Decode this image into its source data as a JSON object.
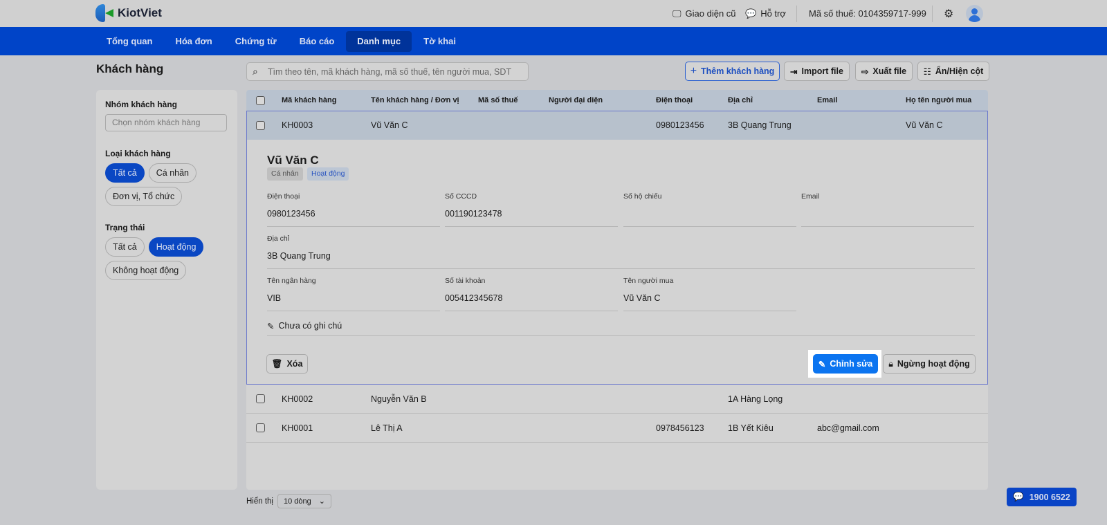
{
  "brand": {
    "name": "KiotViet"
  },
  "topbar": {
    "old_ui": "Giao diện cũ",
    "support": "Hỗ trợ",
    "tax_code": "Mã số thuế: 0104359717-999"
  },
  "nav": [
    "Tổng quan",
    "Hóa đơn",
    "Chứng từ",
    "Báo cáo",
    "Danh mục",
    "Tờ khai"
  ],
  "page": {
    "title": "Khách hàng",
    "search_placeholder": "Tìm theo tên, mã khách hàng, mã số thuế, tên người mua, SDT",
    "actions": {
      "add": "Thêm khách hàng",
      "import": "Import file",
      "export": "Xuất file",
      "columns": "Ẩn/Hiện cột"
    }
  },
  "filters": {
    "group_label": "Nhóm khách hàng",
    "group_placeholder": "Chọn nhóm khách hàng",
    "type_label": "Loại khách hàng",
    "type_options": [
      "Tất cả",
      "Cá nhân",
      "Đơn vị, Tổ chức"
    ],
    "status_label": "Trạng thái",
    "status_options": [
      "Tất cả",
      "Hoạt động",
      "Không hoạt động"
    ]
  },
  "table": {
    "headers": [
      "Mã khách hàng",
      "Tên khách hàng / Đơn vị",
      "Mã số thuế",
      "Người đại diện",
      "Điện thoại",
      "Địa chỉ",
      "Email",
      "Họ tên người mua"
    ],
    "rows": [
      {
        "code": "KH0003",
        "name": "Vũ Văn C",
        "tax": "",
        "rep": "",
        "phone": "0980123456",
        "address": "3B Quang Trung",
        "email": "",
        "buyer": "Vũ Văn C"
      },
      {
        "code": "KH0002",
        "name": "Nguyễn Văn B",
        "tax": "",
        "rep": "",
        "phone": "",
        "address": "1A Hàng Lọng",
        "email": "",
        "buyer": ""
      },
      {
        "code": "KH0001",
        "name": "Lê Thị A",
        "tax": "",
        "rep": "",
        "phone": "0978456123",
        "address": "1B Yết Kiêu",
        "email": "abc@gmail.com",
        "buyer": ""
      }
    ]
  },
  "detail": {
    "name": "Vũ Văn C",
    "tags": [
      "Cá nhân",
      "Hoạt động"
    ],
    "fields": {
      "phone_label": "Điện thoại",
      "phone": "0980123456",
      "cccd_label": "Số CCCD",
      "cccd": "001190123478",
      "passport_label": "Số hộ chiếu",
      "passport": "",
      "email_label": "Email",
      "email": "",
      "address_label": "Địa chỉ",
      "address": "3B Quang Trung",
      "bank_label": "Tên ngân hàng",
      "bank": "VIB",
      "account_label": "Số tài khoản",
      "account": "005412345678",
      "buyer_label": "Tên người mua",
      "buyer": "Vũ Văn C"
    },
    "note": "Chưa có ghi chú",
    "delete": "Xóa",
    "edit": "Chỉnh sửa",
    "deactivate": "Ngừng hoạt động"
  },
  "pagination": {
    "label": "Hiển thị",
    "page_size": "10 dòng"
  },
  "hotline": "1900 6522"
}
